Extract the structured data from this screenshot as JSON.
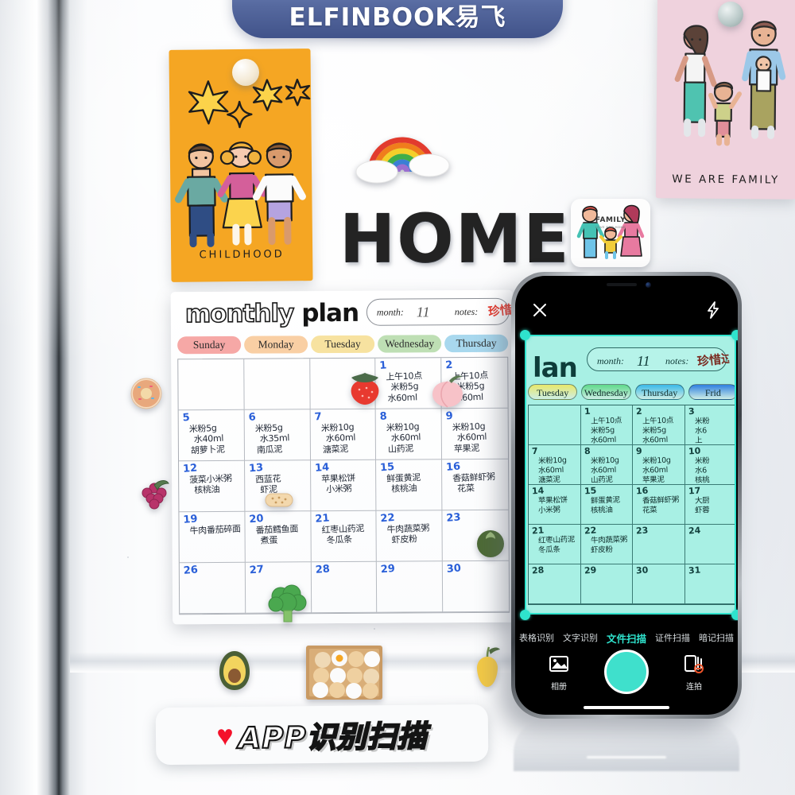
{
  "banner": {
    "text": "ELFINBOOK易飞"
  },
  "posters": {
    "childhood": {
      "caption": "CHILDHOOD"
    },
    "family": {
      "caption": "WE ARE FAMILY"
    }
  },
  "fridge_letters": {
    "text": "HOME"
  },
  "family_sticker": {
    "label": "FAMILY",
    "sub": "LOVE FOR HOME"
  },
  "planner": {
    "title_outline": "monthly",
    "title_solid": "plan",
    "month_label": "month:",
    "month_value": "11",
    "notes_label": "notes:",
    "notes_value": "珍惜",
    "day_headers": [
      {
        "label": "Sunday",
        "color": "#f6a8a6"
      },
      {
        "label": "Monday",
        "color": "#f9cfa4"
      },
      {
        "label": "Tuesday",
        "color": "#f7e2a0"
      },
      {
        "label": "Wednesday",
        "color": "#bedfb4"
      },
      {
        "label": "Thursday",
        "color": "#a8d8ee"
      }
    ],
    "cells": [
      {
        "num": "",
        "lines": []
      },
      {
        "num": "",
        "lines": []
      },
      {
        "num": "",
        "lines": []
      },
      {
        "num": "1",
        "lines": [
          "上午10点",
          "米粉5g",
          "水60ml"
        ]
      },
      {
        "num": "2",
        "lines": [
          "上午10点",
          "米粉5g",
          "水60ml"
        ]
      },
      {
        "num": "5",
        "lines": [
          "米粉5g",
          "水40ml",
          "胡萝卜泥"
        ]
      },
      {
        "num": "6",
        "lines": [
          "米粉5g",
          "水35ml",
          "南瓜泥"
        ]
      },
      {
        "num": "7",
        "lines": [
          "米粉10g",
          "水60ml",
          "溏菜泥"
        ]
      },
      {
        "num": "8",
        "lines": [
          "米粉10g",
          "水60ml",
          "山药泥"
        ]
      },
      {
        "num": "9",
        "lines": [
          "米粉10g",
          "水60ml",
          "苹果泥"
        ]
      },
      {
        "num": "12",
        "lines": [
          "菠菜小米粥",
          "核桃油"
        ]
      },
      {
        "num": "13",
        "lines": [
          "西蓝花",
          "虾泥"
        ]
      },
      {
        "num": "14",
        "lines": [
          "苹果松饼",
          "小米粥"
        ]
      },
      {
        "num": "15",
        "lines": [
          "鲜蛋黄泥",
          "核桃油"
        ]
      },
      {
        "num": "16",
        "lines": [
          "香菇鲜虾粥",
          "花菜"
        ]
      },
      {
        "num": "19",
        "lines": [
          "牛肉番茄碎面"
        ]
      },
      {
        "num": "20",
        "lines": [
          "番茄鳕鱼面",
          "煮蛋"
        ]
      },
      {
        "num": "21",
        "lines": [
          "红枣山药泥",
          "冬瓜条"
        ]
      },
      {
        "num": "22",
        "lines": [
          "牛肉蔬菜粥",
          "虾皮粉"
        ]
      },
      {
        "num": "23",
        "lines": []
      },
      {
        "num": "26",
        "lines": []
      },
      {
        "num": "27",
        "lines": []
      },
      {
        "num": "28",
        "lines": []
      },
      {
        "num": "29",
        "lines": []
      },
      {
        "num": "30",
        "lines": []
      }
    ]
  },
  "phone": {
    "topbar": {
      "close_icon": "close-icon",
      "flash_icon": "flash-icon"
    },
    "scan": {
      "title": "lan",
      "month_label": "month:",
      "month_value": "11",
      "notes_label": "notes:",
      "notes_value": "珍惜过每天,才能过",
      "day_headers": [
        {
          "label": "Tuesday",
          "color": "#e8e86a"
        },
        {
          "label": "Wednesday",
          "color": "#5fd98a"
        },
        {
          "label": "Thursday",
          "color": "#3bb9e8"
        },
        {
          "label": "Frid",
          "color": "#2f7fe0"
        }
      ],
      "cells": [
        {
          "num": "",
          "lines": []
        },
        {
          "num": "1",
          "lines": [
            "上午10点",
            "米粉5g",
            "水60ml"
          ]
        },
        {
          "num": "2",
          "lines": [
            "上午10点",
            "米粉5g",
            "水60ml"
          ]
        },
        {
          "num": "3",
          "lines": [
            "米粉",
            "水6",
            "上"
          ]
        },
        {
          "num": "7",
          "lines": [
            "米粉10g",
            "水60ml",
            "溏菜泥"
          ]
        },
        {
          "num": "8",
          "lines": [
            "米粉10g",
            "水60ml",
            "山药泥"
          ]
        },
        {
          "num": "9",
          "lines": [
            "米粉10g",
            "水60ml",
            "苹果泥"
          ]
        },
        {
          "num": "10",
          "lines": [
            "米粉",
            "水6",
            "核桃"
          ]
        },
        {
          "num": "14",
          "lines": [
            "苹果松饼",
            "小米粥"
          ]
        },
        {
          "num": "15",
          "lines": [
            "鲜蛋黄泥",
            "核桃油"
          ]
        },
        {
          "num": "16",
          "lines": [
            "香菇鲜虾粥",
            "花菜"
          ]
        },
        {
          "num": "17",
          "lines": [
            "大厨",
            "虾蓉"
          ]
        },
        {
          "num": "21",
          "lines": [
            "红枣山药泥",
            "冬瓜条"
          ]
        },
        {
          "num": "22",
          "lines": [
            "牛肉蔬菜粥",
            "虾皮粉"
          ]
        },
        {
          "num": "23",
          "lines": []
        },
        {
          "num": "24",
          "lines": []
        },
        {
          "num": "28",
          "lines": []
        },
        {
          "num": "29",
          "lines": []
        },
        {
          "num": "30",
          "lines": []
        },
        {
          "num": "31",
          "lines": []
        }
      ]
    },
    "modes": [
      {
        "label": "表格识别",
        "active": false
      },
      {
        "label": "文字识别",
        "active": false
      },
      {
        "label": "文件扫描",
        "active": true
      },
      {
        "label": "证件扫描",
        "active": false
      },
      {
        "label": "暗记扫描",
        "active": false
      }
    ],
    "controls": {
      "album_label": "相册",
      "album_icon": "album-icon",
      "shutter_icon": "shutter-button",
      "burst_label": "连拍",
      "burst_icon": "burst-icon"
    }
  },
  "badge": {
    "heart": "♥",
    "text": "APP识别扫描"
  },
  "colors": {
    "brand_banner": "#56699f",
    "accent_cyan": "#2fe3cd",
    "heart_red": "#f4112a",
    "poster_orange": "#f5a623",
    "poster_pink": "#efd2dd",
    "scan_doc": "#a8f0e4",
    "date_blue": "#2a5fd8"
  }
}
